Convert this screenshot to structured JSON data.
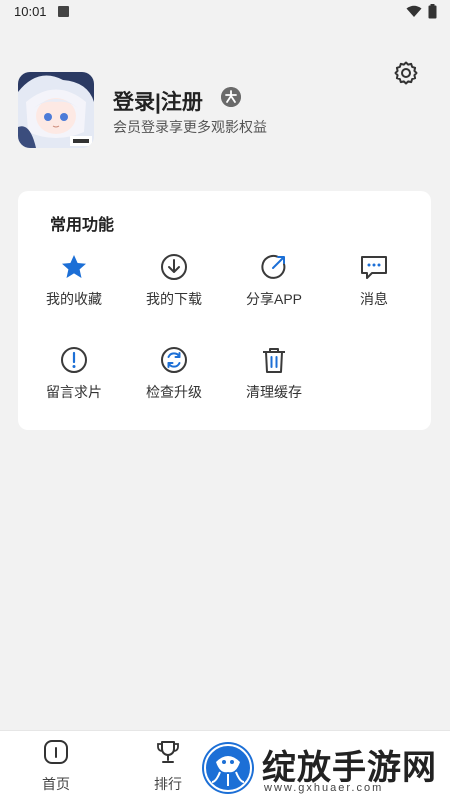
{
  "status": {
    "time": "10:01"
  },
  "profile": {
    "title": "登录|注册",
    "subtitle": "会员登录享更多观影权益"
  },
  "common": {
    "title": "常用功能",
    "items": [
      {
        "label": "我的收藏",
        "icon": "star-icon"
      },
      {
        "label": "我的下载",
        "icon": "download-icon"
      },
      {
        "label": "分享APP",
        "icon": "share-icon"
      },
      {
        "label": "消息",
        "icon": "message-icon"
      },
      {
        "label": "留言求片",
        "icon": "exclamation-icon"
      },
      {
        "label": "检查升级",
        "icon": "refresh-icon"
      },
      {
        "label": "清理缓存",
        "icon": "trash-icon"
      }
    ]
  },
  "nav": {
    "items": [
      {
        "label": "首页",
        "icon": "home-icon"
      },
      {
        "label": "排行",
        "icon": "trophy-icon"
      }
    ]
  },
  "watermark": {
    "text": "绽放手游网",
    "url": "www.gxhuaer.com"
  },
  "colors": {
    "accent": "#1c6fd6",
    "icon": "#3a3a3a",
    "background": "#f2f2f2"
  }
}
